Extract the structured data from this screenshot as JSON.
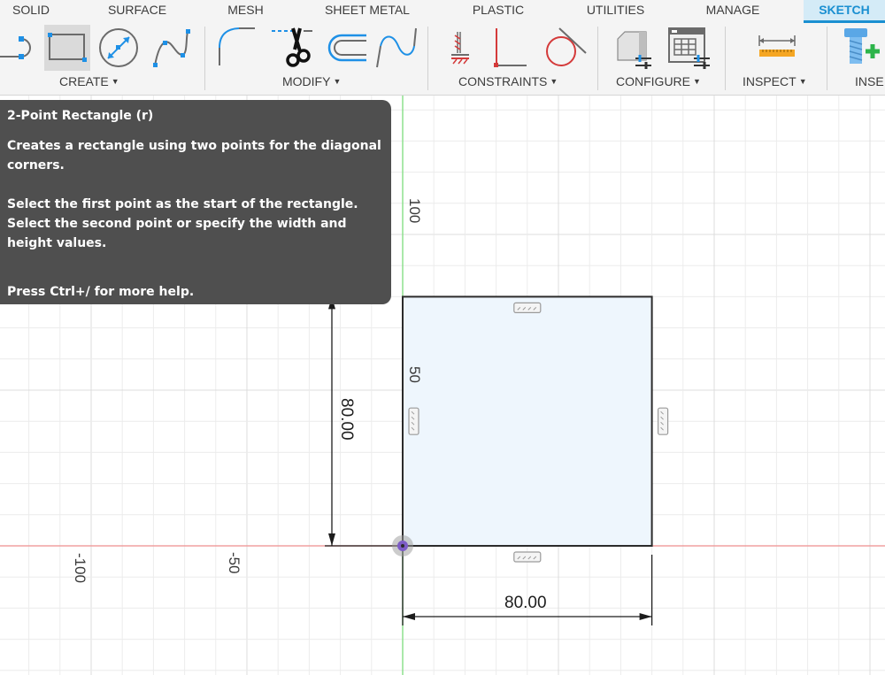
{
  "tabs": [
    {
      "label": "SOLID",
      "active": false
    },
    {
      "label": "SURFACE",
      "active": false
    },
    {
      "label": "MESH",
      "active": false
    },
    {
      "label": "SHEET METAL",
      "active": false
    },
    {
      "label": "PLASTIC",
      "active": false
    },
    {
      "label": "UTILITIES",
      "active": false
    },
    {
      "label": "MANAGE",
      "active": false
    },
    {
      "label": "SKETCH",
      "active": true
    }
  ],
  "groups": {
    "create": {
      "label": "CREATE",
      "tools": [
        "arc-icon",
        "2-point-rectangle-icon",
        "center-diameter-circle-icon",
        "spline-icon"
      ],
      "selected_tool": "2-point-rectangle-icon"
    },
    "modify": {
      "label": "MODIFY",
      "tools": [
        "fillet-icon",
        "trim-icon",
        "offset-icon",
        "spline-edit-icon"
      ]
    },
    "constraints": {
      "label": "CONSTRAINTS",
      "tools": [
        "fix-constraint-icon",
        "perpendicular-constraint-icon",
        "tangent-constraint-icon"
      ]
    },
    "configure": {
      "label": "CONFIGURE",
      "tools": [
        "change-parameters-icon",
        "configuration-table-icon"
      ]
    },
    "inspect": {
      "label": "INSPECT",
      "tools": [
        "measure-icon"
      ]
    },
    "insert": {
      "label": "INSE",
      "tools": [
        "insert-mcmaster-bolt-icon"
      ]
    }
  },
  "tooltip": {
    "title": "2-Point Rectangle (r)",
    "line1": "Creates a rectangle using two points for the diagonal corners.",
    "line2": "Select the first point as the start of the rectangle.",
    "line3": "Select the second point or specify the width and height values.",
    "line4": "Press Ctrl+/ for more help."
  },
  "canvas": {
    "axis_labels": {
      "y_100": "100",
      "y_50": "50",
      "x_neg100": "-100",
      "x_neg50": "-50"
    },
    "rectangle": {
      "width": 80,
      "height": 80,
      "fill": "#eef6fd"
    },
    "dimensions": {
      "width_text": "80.00",
      "height_text": "80.00"
    },
    "colors": {
      "x_axis": "#f0a0a0",
      "y_axis": "#8ee08e",
      "origin": "#7d5cc6",
      "accent": "#1a8fd1"
    }
  }
}
